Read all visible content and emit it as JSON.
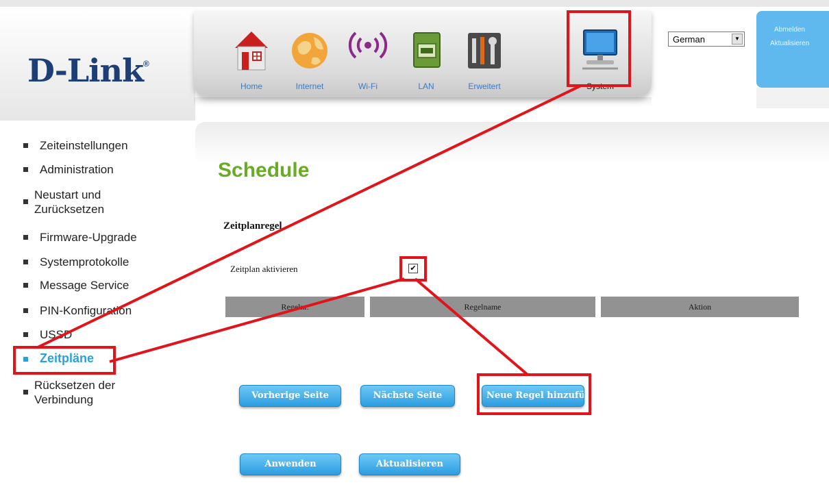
{
  "brand": {
    "logo_text": "D-Link",
    "logo_mark": "®",
    "logo_color": "#1d3f75"
  },
  "nav": {
    "items": [
      {
        "label": "Home",
        "icon": "home-icon"
      },
      {
        "label": "Internet",
        "icon": "globe-icon"
      },
      {
        "label": "Wi-Fi",
        "icon": "wifi-icon"
      },
      {
        "label": "LAN",
        "icon": "lan-port-icon"
      },
      {
        "label": "Erweitert",
        "icon": "tools-icon"
      },
      {
        "label": "System",
        "icon": "monitor-icon",
        "active": true
      }
    ],
    "link_color": "#3a7ac6"
  },
  "language": {
    "selected": "German"
  },
  "account": {
    "logout_label": "Abmelden",
    "refresh_label": "Aktualisieren",
    "panel_color": "#5fb8ee"
  },
  "sidebar": {
    "items": [
      {
        "label": "Zeiteinstellungen"
      },
      {
        "label": "Administration"
      },
      {
        "label": "Neustart und\nZurücksetzen"
      },
      {
        "label": "Firmware-Upgrade"
      },
      {
        "label": "Systemprotokolle"
      },
      {
        "label": "Message Service"
      },
      {
        "label": "PIN-Konfiguration"
      },
      {
        "label": "USSD"
      },
      {
        "label": "Zeitpläne",
        "active": true
      },
      {
        "label": "Rücksetzen der\nVerbindung"
      }
    ],
    "active_color": "#27a3db"
  },
  "main": {
    "title": "Schedule",
    "title_color": "#6aab26",
    "section_label": "Zeitplanregel",
    "enable_label": "Zeitplan aktivieren",
    "enable_checked": true,
    "checkbox_mark": "✔",
    "table_headers": [
      "Regelnr.",
      "Regelname",
      "Aktion"
    ],
    "buttons": {
      "prev": "Vorherige Seite",
      "next": "Nächste Seite",
      "add_rule": "Neue Regel hinzufügen",
      "apply": "Anwenden",
      "refresh": "Aktualisieren"
    },
    "button_color": "#2c9de0"
  },
  "annotation": {
    "highlight_color": "#e0151b"
  }
}
